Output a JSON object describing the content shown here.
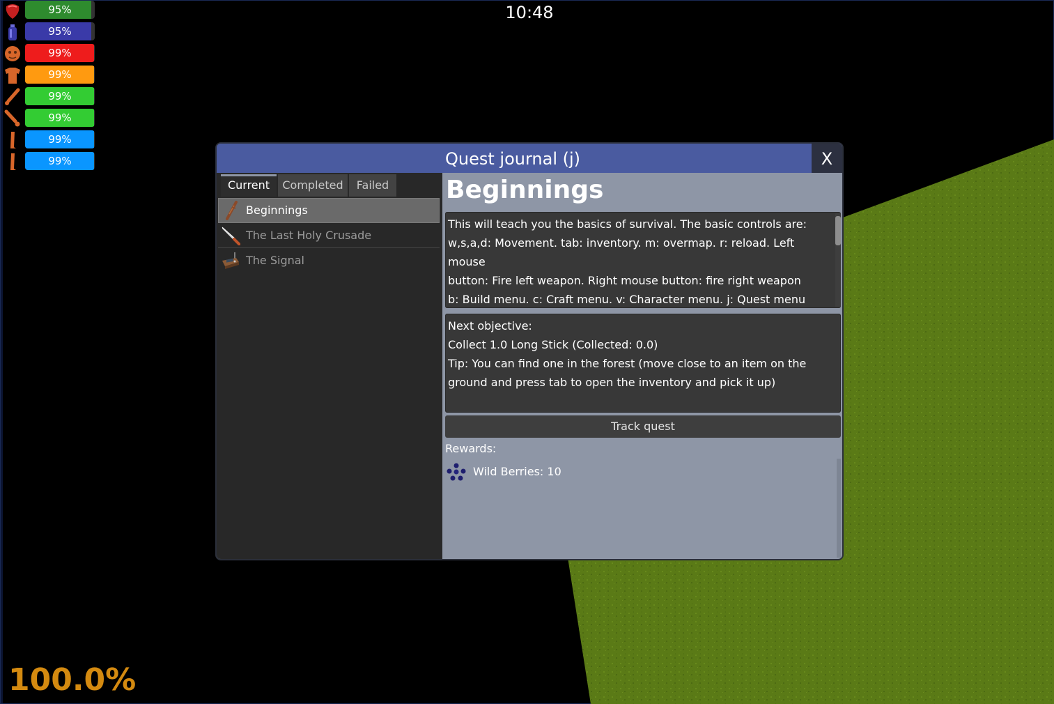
{
  "hud": {
    "clock": "10:48",
    "zoom": "100.0%",
    "stats": [
      {
        "icon": "stomach-icon",
        "value": 95,
        "label": "95%",
        "color": "#2e8b2e"
      },
      {
        "icon": "water-bottle-icon",
        "value": 95,
        "label": "95%",
        "color": "#3a3aa8"
      },
      {
        "icon": "head-icon",
        "value": 99,
        "label": "99%",
        "color": "#ee1c1c"
      },
      {
        "icon": "torso-icon",
        "value": 99,
        "label": "99%",
        "color": "#ff9a10"
      },
      {
        "icon": "left-arm-icon",
        "value": 99,
        "label": "99%",
        "color": "#33cc33"
      },
      {
        "icon": "right-arm-icon",
        "value": 99,
        "label": "99%",
        "color": "#33cc33"
      },
      {
        "icon": "left-leg-icon",
        "value": 99,
        "label": "99%",
        "color": "#0a96ff"
      },
      {
        "icon": "right-leg-icon",
        "value": 99,
        "label": "99%",
        "color": "#0a96ff"
      }
    ]
  },
  "quest_journal": {
    "title": "Quest journal (j)",
    "close_label": "X",
    "tabs": [
      {
        "label": "Current",
        "active": true
      },
      {
        "label": "Completed",
        "active": false
      },
      {
        "label": "Failed",
        "active": false
      }
    ],
    "quests": [
      {
        "label": "Beginnings",
        "icon": "wooden-stick-icon",
        "selected": true
      },
      {
        "label": "The Last Holy Crusade",
        "icon": "machete-icon",
        "selected": false
      },
      {
        "label": "The Signal",
        "icon": "radio-device-icon",
        "selected": false
      }
    ],
    "selected_quest": {
      "title": "Beginnings",
      "description_lines": [
        "This will teach you the basics of survival. The basic controls are:",
        "w,s,a,d: Movement. tab: inventory. m: overmap. r: reload. Left mouse",
        "button: Fire left weapon. Right mouse button: fire right weapon",
        "b: Build menu. c: Craft menu. v: Character menu. j: Quest menu"
      ],
      "objective_lines": [
        "Next objective:",
        "Collect 1.0 Long Stick (Collected: 0.0)",
        "Tip: You can find one in the forest (move close to an item on the",
        "ground and press tab to open the inventory and pick it up)"
      ],
      "track_label": "Track quest",
      "rewards_label": "Rewards:",
      "rewards": [
        {
          "icon": "wild-berries-icon",
          "label": "Wild Berries: 10"
        }
      ]
    }
  }
}
